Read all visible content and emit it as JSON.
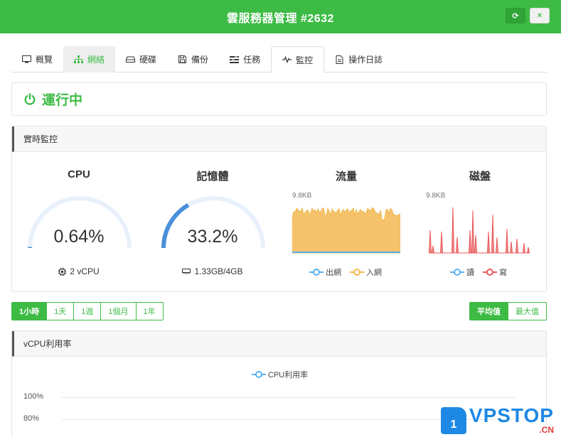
{
  "header": {
    "title": "雲服務器管理 #2632",
    "refresh_icon": "refresh-icon",
    "close_icon": "close-icon",
    "refresh_glyph": "⟳",
    "close_glyph": "×"
  },
  "tabs": [
    {
      "label": "概覽",
      "icon": "monitor-icon"
    },
    {
      "label": "網絡",
      "icon": "sitemap-icon"
    },
    {
      "label": "硬碟",
      "icon": "hdd-icon"
    },
    {
      "label": "備份",
      "icon": "floppy-icon"
    },
    {
      "label": "任務",
      "icon": "tasks-icon"
    },
    {
      "label": "監控",
      "icon": "pulse-icon"
    },
    {
      "label": "操作日誌",
      "icon": "file-icon"
    }
  ],
  "status": {
    "text": "運行中",
    "color": "#3dbb45"
  },
  "realtime": {
    "title": "實時監控",
    "cpu": {
      "title": "CPU",
      "value": "0.64%",
      "fraction": 0.0064,
      "foot": "2 vCPU"
    },
    "memory": {
      "title": "記憶體",
      "value": "33.2%",
      "fraction": 0.332,
      "foot": "1.33GB/4GB"
    },
    "traffic": {
      "title": "流量",
      "ymax_label": "9.8KB",
      "legend": [
        "出網",
        "入網"
      ],
      "colors": [
        "#5ab1ef",
        "#f5b94e"
      ]
    },
    "disk": {
      "title": "磁盤",
      "ymax_label": "9.8KB",
      "legend": [
        "讀",
        "寫"
      ],
      "colors": [
        "#5ab1ef",
        "#e85a5a"
      ]
    }
  },
  "ranges": {
    "items": [
      "1小時",
      "1天",
      "1週",
      "1個月",
      "1年"
    ],
    "active": "1小時"
  },
  "aggregation": {
    "items": [
      "平均值",
      "最大值"
    ],
    "active": "平均值"
  },
  "vcpu_chart": {
    "title": "vCPU利用率",
    "legend": "CPU利用率",
    "yticks": [
      "100%",
      "80%"
    ]
  },
  "watermark": {
    "badge": "1",
    "main": "VPSTOP",
    "sub": ".CN"
  }
}
